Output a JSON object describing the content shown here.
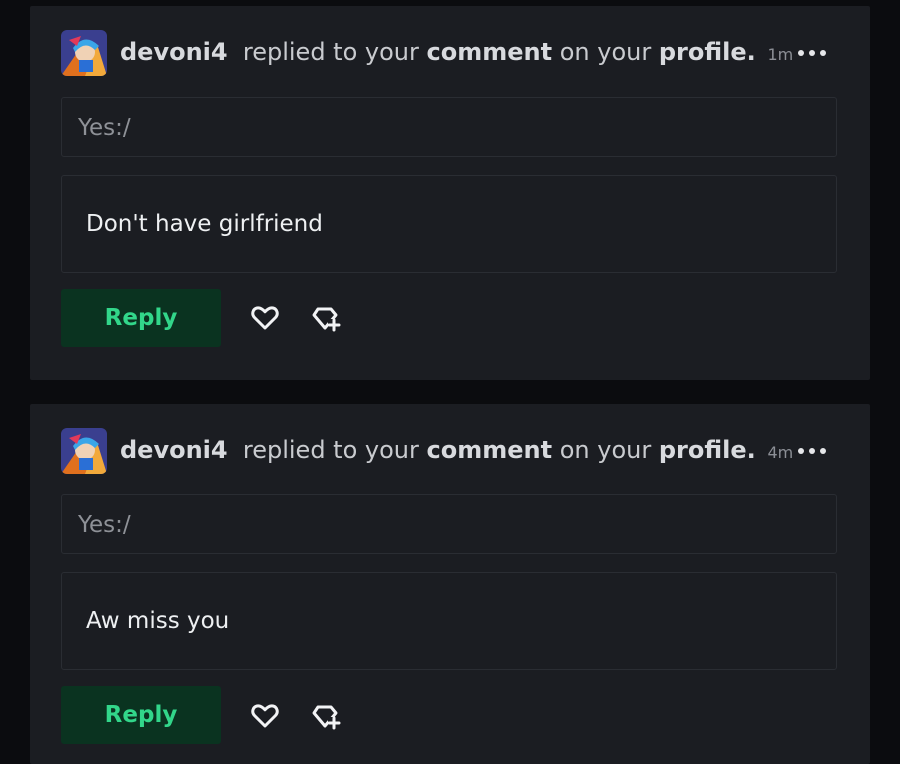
{
  "notifications": [
    {
      "username": "devoni4",
      "text_replied": "replied to your",
      "text_comment": "comment",
      "text_on": "on your",
      "text_profile": "profile.",
      "time": "1m",
      "quote": "Yes:/",
      "message": "Don't have girlfriend",
      "reply_label": "Reply",
      "avatar_icon": "user-avatar",
      "more_icon": "more-dots-icon",
      "like_icon": "heart-icon",
      "award_icon": "gem-plus-icon"
    },
    {
      "username": "devoni4",
      "text_replied": "replied to your",
      "text_comment": "comment",
      "text_on": "on your",
      "text_profile": "profile.",
      "time": "4m",
      "quote": "Yes:/",
      "message": "Aw miss you",
      "reply_label": "Reply",
      "avatar_icon": "user-avatar",
      "more_icon": "more-dots-icon",
      "like_icon": "heart-icon",
      "award_icon": "gem-plus-icon"
    }
  ],
  "colors": {
    "background": "#0b0c0f",
    "card": "#1b1d22",
    "reply_button_bg": "#0a3320",
    "reply_button_text": "#32d68a"
  }
}
